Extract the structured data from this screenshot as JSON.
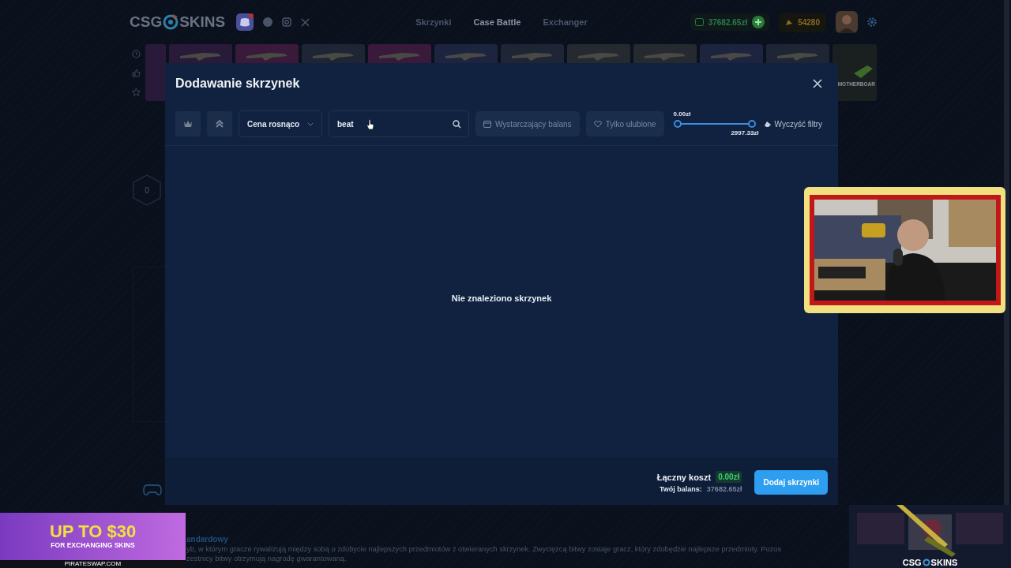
{
  "header": {
    "logo_left": "CSG",
    "logo_right": "SKINS",
    "nav": [
      {
        "label": "Skrzynki",
        "selected": false
      },
      {
        "label": "Case Battle",
        "selected": true
      },
      {
        "label": "Exchanger",
        "selected": false
      }
    ],
    "balance": "37682.65zł",
    "points": "54280"
  },
  "case_strip": {
    "last_card_label": "MOTHERBOAR"
  },
  "battle": {
    "player_count": "0",
    "mode_title": "andardowy",
    "description": [
      "yb, w którym gracze rywalizują między sobą o zdobycie najlepszych przedmiotów z otwieranych skrzynek. Zwycięzcą bitwy zostaje gracz, który zdobędzie najlepsze przedmioty. Pozos",
      "zestnicy bitwy otrzymują nagrodę gwarantowaną."
    ]
  },
  "modal": {
    "title": "Dodawanie skrzynek",
    "filters": {
      "sort": "Cena rosnąco",
      "search_value": "beat",
      "toggles": [
        {
          "label": "Wystarczający balans",
          "kind": "wallet",
          "selected": false
        },
        {
          "label": "Tylko ulubione",
          "kind": "heart",
          "selected": false
        }
      ],
      "range": [
        {
          "label": "0.00zł",
          "level": 0
        },
        {
          "label": "2997.33zł",
          "level": 1
        }
      ],
      "clear": "Wyczyść filtry"
    },
    "empty_message": "Nie znaleziono skrzynek",
    "footer": {
      "total_label": "Łączny koszt",
      "total": "0.00zł",
      "balance_label": "Twój balans:",
      "balance": "37682.65zł",
      "add_button": "Dodaj skrzynki"
    }
  },
  "ad_banner": {
    "headline": "UP TO $30",
    "subline": "FOR EXCHANGING SKINS",
    "site": "PIRATESWAP.COM"
  },
  "corner_overlay": {
    "kind": "picture",
    "logo_left": "CSG",
    "logo_right": "SKINS"
  }
}
